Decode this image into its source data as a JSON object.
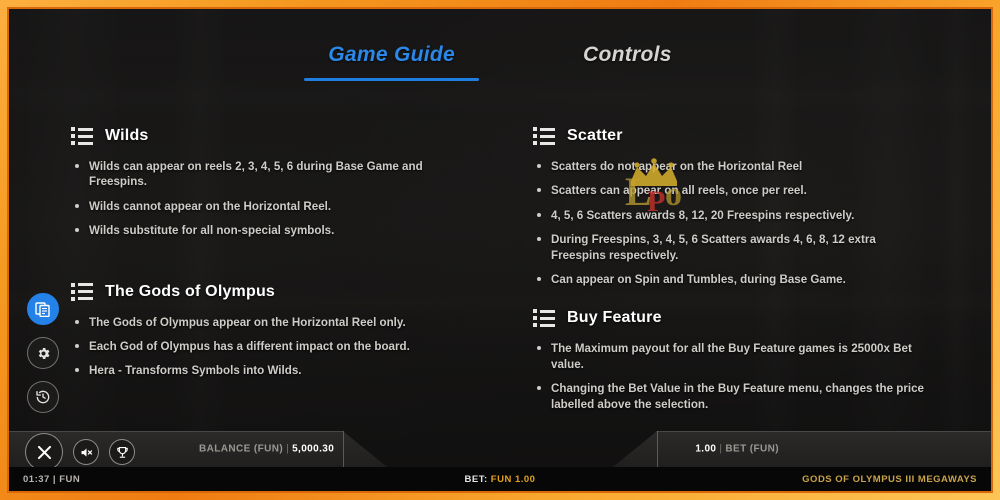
{
  "window": {
    "frame_color": "#f59a20",
    "accent_blue": "#2b87e8",
    "gold": "#e0a21c"
  },
  "tabs": [
    {
      "label": "Game Guide",
      "active": true
    },
    {
      "label": "Controls",
      "active": false
    }
  ],
  "sections": {
    "left": [
      {
        "icon": "list-icon",
        "title": "Wilds",
        "bullets": [
          "Wilds can appear on reels 2, 3, 4, 5, 6 during Base Game and Freespins.",
          "Wilds cannot appear on the Horizontal Reel.",
          "Wilds substitute for all non-special symbols."
        ]
      },
      {
        "icon": "list-icon",
        "title": "The Gods of Olympus",
        "bullets": [
          "The Gods of Olympus appear on the Horizontal Reel only.",
          "Each God of Olympus has a different impact on the board.",
          "Hera - Transforms Symbols into Wilds."
        ]
      }
    ],
    "right": [
      {
        "icon": "list-icon",
        "title": "Scatter",
        "bullets": [
          "Scatters do not appear on the Horizontal Reel",
          "Scatters can appear on all reels, once per reel.",
          "4, 5, 6 Scatters awards 8, 12, 20 Freespins respectively.",
          "During Freespins, 3, 4, 5, 6 Scatters awards 4, 6, 8, 12 extra Freespins respectively.",
          "Can appear on Spin and Tumbles, during Base Game."
        ]
      },
      {
        "icon": "list-icon",
        "title": "Buy Feature",
        "bullets": [
          "The Maximum payout for all the Buy Feature games is 25000x Bet value.",
          "Changing the Bet Value in the Buy Feature menu, changes the price labelled above the selection."
        ]
      }
    ]
  },
  "watermark": {
    "text": "LP",
    "icon": "crown-icon"
  },
  "rail": [
    {
      "icon": "paytable-icon",
      "active": true
    },
    {
      "icon": "gear-icon",
      "active": false
    },
    {
      "icon": "history-icon",
      "active": false
    }
  ],
  "bottom_icons": [
    {
      "icon": "close-icon"
    },
    {
      "icon": "mute-icon"
    },
    {
      "icon": "trophy-icon"
    }
  ],
  "statusbar": {
    "balance_label": "BALANCE (FUN)",
    "balance_value": "5,000.30",
    "bet_value": "1.00",
    "bet_label": "BET (FUN)",
    "separator": "|"
  },
  "footer": {
    "clock": "01:37 | FUN",
    "bet_key": "BET:",
    "bet_val": "FUN 1.00",
    "game_title": "GODS OF OLYMPUS III MEGAWAYS"
  }
}
